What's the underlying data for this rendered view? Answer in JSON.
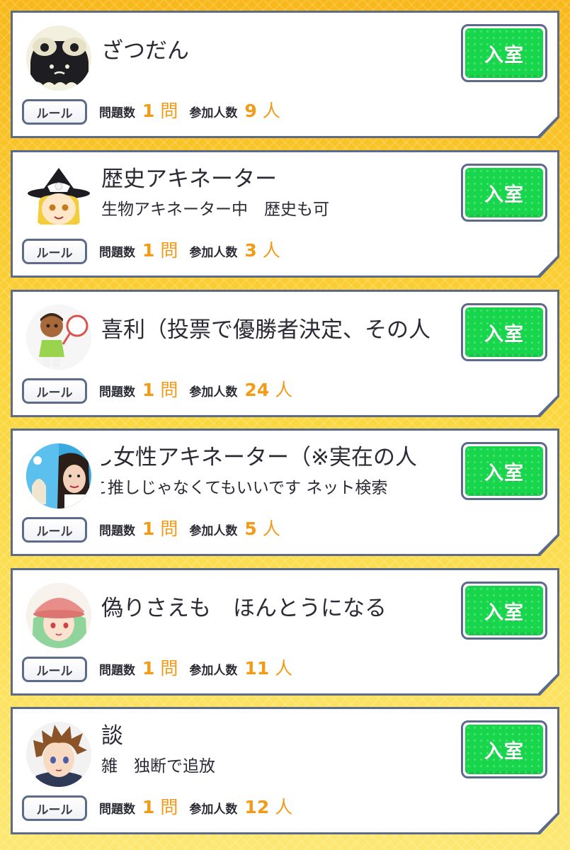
{
  "rule_label": "ルール",
  "enter_label": "入室",
  "questions_label": "問題数",
  "participants_label": "参加人数",
  "question_unit": "問",
  "person_unit": "人",
  "colors": {
    "accent_orange": "#f39a17",
    "enter_green": "#17d64c",
    "frame": "#5d6b8a",
    "background": "#f7c21c"
  },
  "rooms": [
    {
      "title": "ざつだん",
      "subtitle": "",
      "questions": "1",
      "participants": "9",
      "avatar_icon": "black-ghost-avatar-icon"
    },
    {
      "title": "歴史アキネーター",
      "subtitle": "生物アキネーター中　歴史も可",
      "questions": "1",
      "participants": "3",
      "avatar_icon": "witch-character-avatar-icon"
    },
    {
      "title": "喜利（投票で優勝者決定、その人",
      "subtitle": "",
      "questions": "1",
      "participants": "24",
      "avatar_icon": "tennis-player-avatar-icon"
    },
    {
      "title": "し女性アキネーター（※実在の人",
      "subtitle": "こ推しじゃなくてもいいです ネット検索",
      "questions": "1",
      "participants": "5",
      "avatar_icon": "woman-photo-avatar-icon"
    },
    {
      "title": "偽りさえも　ほんとうになる",
      "subtitle": "",
      "questions": "1",
      "participants": "11",
      "avatar_icon": "green-hair-girl-avatar-icon"
    },
    {
      "title": "談",
      "subtitle": "雑　独断で追放",
      "questions": "1",
      "participants": "12",
      "avatar_icon": "brown-hair-boy-avatar-icon"
    }
  ]
}
